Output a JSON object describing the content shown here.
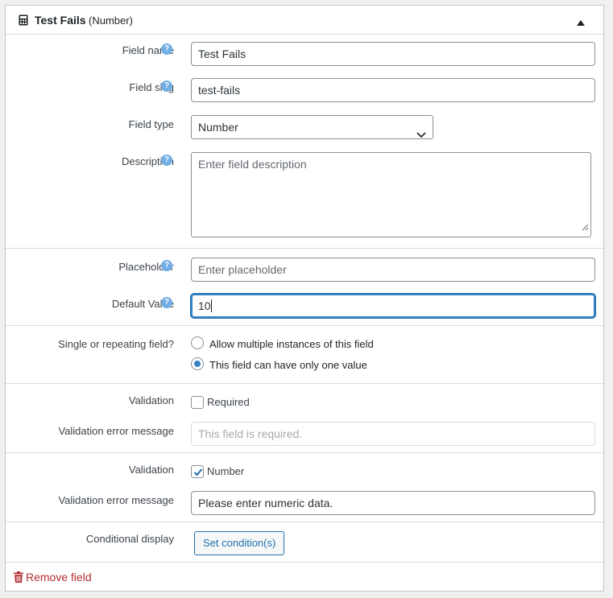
{
  "header": {
    "title": "Test Fails",
    "subtitle": "(Number)",
    "icon": "calculator-icon",
    "toggle_icon": "triangle-up-icon"
  },
  "fields": {
    "field_name": {
      "label": "Field name",
      "value": "Test Fails"
    },
    "field_slug": {
      "label": "Field slug",
      "value": "test-fails"
    },
    "field_type": {
      "label": "Field type",
      "value": "Number"
    },
    "description": {
      "label": "Description",
      "placeholder": "Enter field description"
    },
    "placeholder": {
      "label": "Placeholder",
      "placeholder": "Enter placeholder"
    },
    "default_value": {
      "label": "Default Value",
      "value": "10"
    },
    "repeating": {
      "label": "Single or repeating field?",
      "options": [
        "Allow multiple instances of this field",
        "This field can have only one value"
      ],
      "selected": "This field can have only one value"
    },
    "validation_required": {
      "label": "Validation",
      "checkbox_label": "Required",
      "checked": false,
      "error_label": "Validation error message",
      "error_value": "This field is required."
    },
    "validation_number": {
      "label": "Validation",
      "checkbox_label": "Number",
      "checked": true,
      "error_label": "Validation error message",
      "error_value": "Please enter numeric data."
    },
    "conditional": {
      "label": "Conditional display",
      "button": "Set condition(s)"
    }
  },
  "help_glyph": "?",
  "footer": {
    "remove_label": "Remove field",
    "icon": "trash-icon"
  },
  "colors": {
    "accent": "#2271b1",
    "danger": "#b32d2e",
    "help": "#72aee6"
  }
}
